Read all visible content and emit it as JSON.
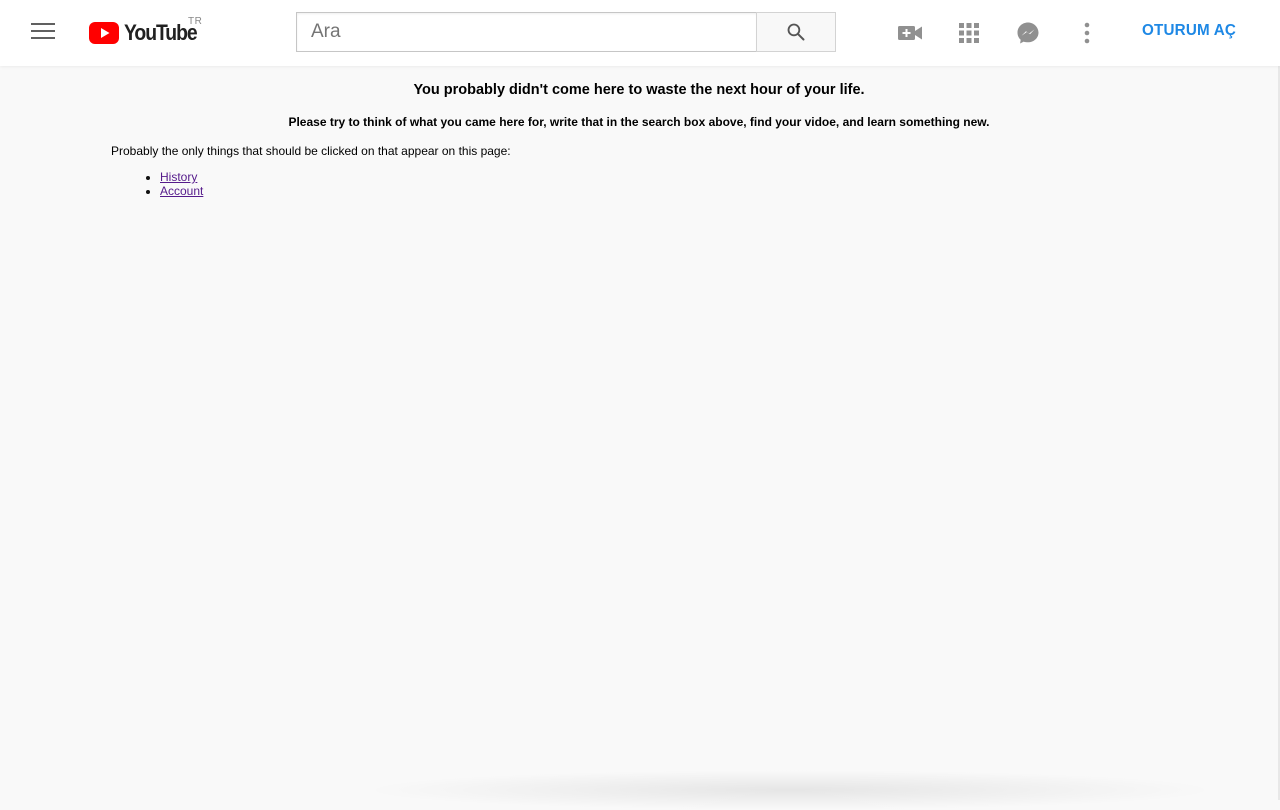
{
  "header": {
    "logo_text": "YouTube",
    "region": "TR",
    "search_placeholder": "Ara",
    "signin_label": "OTURUM AÇ",
    "icons": [
      "menu-icon",
      "search-icon",
      "video-camera-plus-icon",
      "apps-grid-icon",
      "messages-icon",
      "more-vertical-icon"
    ]
  },
  "content": {
    "headline": "You probably didn't come here to waste the next hour of your life.",
    "subline": "Please try to think of what you came here for, write that in the search box above, find your vidoe, and learn something new.",
    "intro": "Probably the only things that should be clicked on that appear on this page:",
    "links": [
      "History",
      "Account"
    ]
  },
  "colors": {
    "brand_red": "#ff0000",
    "signin_blue": "#1e88e5",
    "visited_link": "#551a8b",
    "page_bg": "#f9f9f9"
  }
}
